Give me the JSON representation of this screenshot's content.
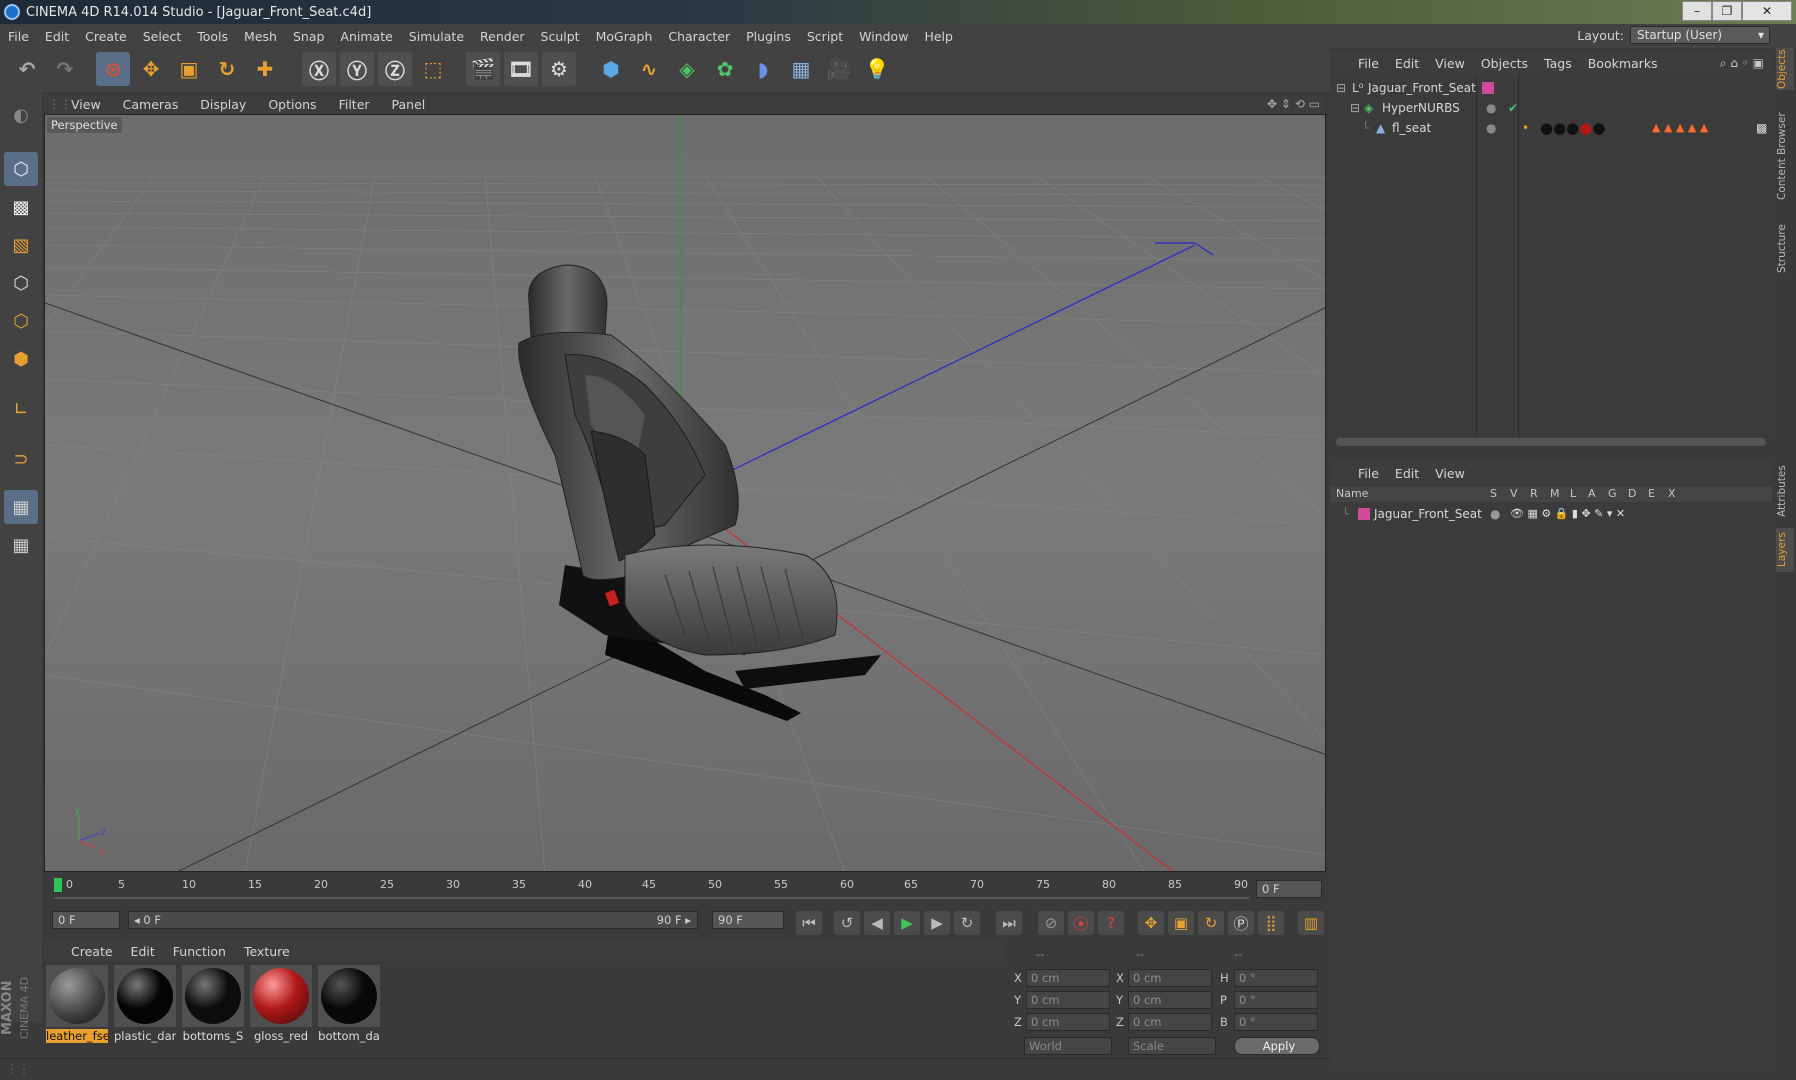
{
  "window": {
    "title": "CINEMA 4D R14.014 Studio - [Jaguar_Front_Seat.c4d]",
    "controls": [
      "–",
      "❐",
      "✕"
    ]
  },
  "menu": [
    "File",
    "Edit",
    "Create",
    "Select",
    "Tools",
    "Mesh",
    "Snap",
    "Animate",
    "Simulate",
    "Render",
    "Sculpt",
    "MoGraph",
    "Character",
    "Plugins",
    "Script",
    "Window",
    "Help"
  ],
  "layout": {
    "label": "Layout:",
    "value": "Startup (User)"
  },
  "viewport": {
    "menu": [
      "View",
      "Cameras",
      "Display",
      "Options",
      "Filter",
      "Panel"
    ],
    "label": "Perspective"
  },
  "timeline": {
    "ticks": [
      "0",
      "5",
      "10",
      "15",
      "20",
      "25",
      "30",
      "35",
      "40",
      "45",
      "50",
      "55",
      "60",
      "65",
      "70",
      "75",
      "80",
      "85",
      "90"
    ],
    "current_frame": "0 F",
    "start_field": "0 F",
    "range_start": "◂ 0 F",
    "range_end": "90 F ▸",
    "end_field": "90 F"
  },
  "materials": {
    "menu": [
      "Create",
      "Edit",
      "Function",
      "Texture"
    ],
    "items": [
      {
        "label": "leather_fse",
        "color": "#3c3c3c"
      },
      {
        "label": "plastic_dar",
        "color": "#050505"
      },
      {
        "label": "bottoms_S",
        "color": "#0c0c0c"
      },
      {
        "label": "gloss_red",
        "color": "#b01818"
      },
      {
        "label": "bottom_da",
        "color": "#080808"
      }
    ]
  },
  "coords": {
    "headers": [
      "--",
      "--",
      "--"
    ],
    "pos_labels": [
      "X",
      "Y",
      "Z"
    ],
    "size_labels": [
      "X",
      "Y",
      "Z"
    ],
    "rot_labels": [
      "H",
      "P",
      "B"
    ],
    "pos_values": [
      "0 cm",
      "0 cm",
      "0 cm"
    ],
    "size_values": [
      "0 cm",
      "0 cm",
      "0 cm"
    ],
    "rot_values": [
      "0 °",
      "0 °",
      "0 °"
    ],
    "mode": "World",
    "scale": "Scale",
    "apply": "Apply"
  },
  "objects_panel": {
    "menu": [
      "File",
      "Edit",
      "View",
      "Objects",
      "Tags",
      "Bookmarks"
    ],
    "items": [
      {
        "name": "Jaguar_Front_Seat"
      },
      {
        "name": "HyperNURBS"
      },
      {
        "name": "fl_seat"
      }
    ]
  },
  "layers_panel": {
    "menu": [
      "File",
      "Edit",
      "View"
    ],
    "columns": [
      "Name",
      "S",
      "V",
      "R",
      "M",
      "L",
      "A",
      "G",
      "D",
      "E",
      "X"
    ],
    "items": [
      {
        "name": "Jaguar_Front_Seat"
      }
    ]
  },
  "side_tabs": [
    "Objects",
    "Content Browser",
    "Structure",
    "Attributes",
    "Layers"
  ],
  "branding": {
    "line1": "MAXON",
    "line2": "CINEMA 4D"
  }
}
